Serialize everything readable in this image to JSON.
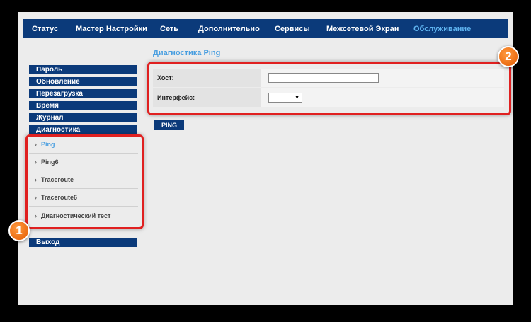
{
  "nav": {
    "items": [
      {
        "label": "Статус"
      },
      {
        "label": "Мастер Настройки"
      },
      {
        "label": "Сеть"
      },
      {
        "label": "Дополнительно"
      },
      {
        "label": "Сервисы"
      },
      {
        "label": "Межсетевой Экран"
      },
      {
        "label": "Обслуживание"
      }
    ],
    "active_color": "#5fb4f0",
    "bar_color": "#0b3a7a"
  },
  "page": {
    "title": "Диагностика Ping"
  },
  "sidebar": {
    "items": [
      {
        "label": "Пароль"
      },
      {
        "label": "Обновление"
      },
      {
        "label": "Перезагрузка"
      },
      {
        "label": "Время"
      },
      {
        "label": "Журнал"
      },
      {
        "label": "Диагностика"
      }
    ],
    "submenu": [
      {
        "label": "Ping"
      },
      {
        "label": "Ping6"
      },
      {
        "label": "Traceroute"
      },
      {
        "label": "Traceroute6"
      },
      {
        "label": "Диагностический тест"
      }
    ],
    "logout_label": "Выход"
  },
  "form": {
    "host_label": "Хост:",
    "host_value": "",
    "interface_label": "Интерфейс:",
    "interface_value": ""
  },
  "actions": {
    "ping_label": "PING"
  },
  "annotations": {
    "badge1": "1",
    "badge2": "2",
    "highlight_color": "#e02020",
    "badge_color": "#e45a00"
  }
}
